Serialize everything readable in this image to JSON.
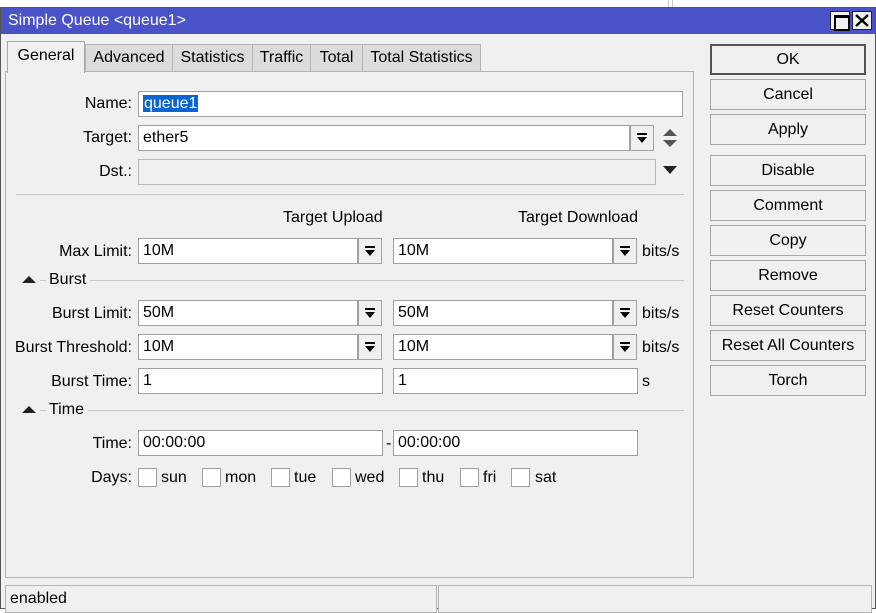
{
  "window": {
    "title": "Simple Queue <queue1>"
  },
  "tabs": [
    {
      "label": "General"
    },
    {
      "label": "Advanced"
    },
    {
      "label": "Statistics"
    },
    {
      "label": "Traffic"
    },
    {
      "label": "Total"
    },
    {
      "label": "Total Statistics"
    }
  ],
  "general": {
    "name_label": "Name:",
    "name_value": "queue1",
    "target_label": "Target:",
    "target_value": "ether5",
    "dst_label": "Dst.:",
    "dst_value": "",
    "col_upload": "Target Upload",
    "col_download": "Target Download",
    "max_limit_label": "Max Limit:",
    "max_limit_upload": "10M",
    "max_limit_download": "10M",
    "max_limit_unit": "bits/s",
    "burst_section": "Burst",
    "burst_limit_label": "Burst Limit:",
    "burst_limit_upload": "50M",
    "burst_limit_download": "50M",
    "burst_limit_unit": "bits/s",
    "burst_threshold_label": "Burst Threshold:",
    "burst_threshold_upload": "10M",
    "burst_threshold_download": "10M",
    "burst_threshold_unit": "bits/s",
    "burst_time_label": "Burst Time:",
    "burst_time_upload": "1",
    "burst_time_download": "1",
    "burst_time_unit": "s",
    "time_section": "Time",
    "time_label": "Time:",
    "time_start": "00:00:00",
    "time_dash": "-",
    "time_end": "00:00:00",
    "days_label": "Days:",
    "days": [
      {
        "label": "sun",
        "checked": false
      },
      {
        "label": "mon",
        "checked": false
      },
      {
        "label": "tue",
        "checked": false
      },
      {
        "label": "wed",
        "checked": false
      },
      {
        "label": "thu",
        "checked": false
      },
      {
        "label": "fri",
        "checked": false
      },
      {
        "label": "sat",
        "checked": false
      }
    ]
  },
  "buttons": {
    "ok": "OK",
    "cancel": "Cancel",
    "apply": "Apply",
    "disable": "Disable",
    "comment": "Comment",
    "copy": "Copy",
    "remove": "Remove",
    "reset_counters": "Reset Counters",
    "reset_all_counters": "Reset All Counters",
    "torch": "Torch"
  },
  "status": {
    "left": "enabled",
    "right": ""
  },
  "icons": {
    "maximize": "maximize-icon",
    "close": "close-icon",
    "dropdown": "dropdown-arrow-icon",
    "updown": "up-down-arrow-icon",
    "collapse": "collapse-triangle-icon"
  },
  "colors": {
    "titlebar": "#4a52c8",
    "selection": "#0a64d2",
    "window_bg": "#f0f0f0"
  }
}
